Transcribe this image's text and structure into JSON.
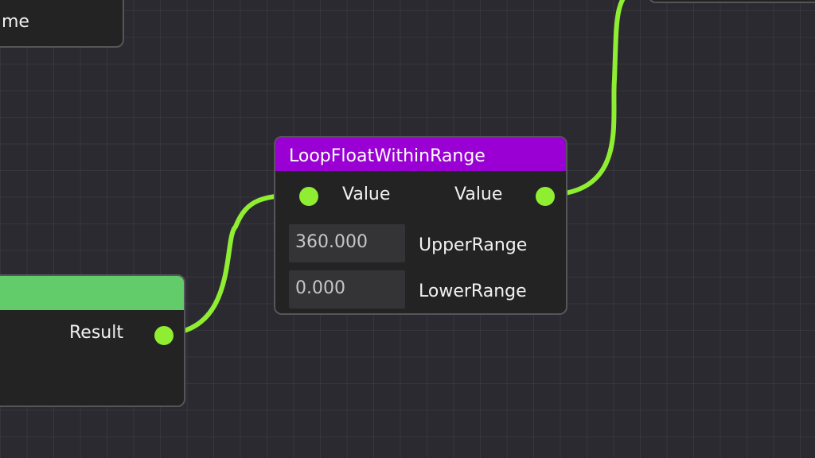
{
  "colors": {
    "background": "#2b2a30",
    "grid_line": "#38373d",
    "node_body": "#232323",
    "node_border": "#55555a",
    "wire": "#8fee32",
    "loop_header": "#9a00d4",
    "math_header": "#62cc6a",
    "field_bg": "#343437"
  },
  "top_left_node": {
    "partial_label": "me"
  },
  "loop_node": {
    "title": "LoopFloatWithinRange",
    "input_label": "Value",
    "output_label": "Value",
    "upper": {
      "value": "360.000",
      "label": "UpperRange"
    },
    "lower": {
      "value": "0.000",
      "label": "LowerRange"
    }
  },
  "left_node": {
    "output_label": "Result"
  }
}
